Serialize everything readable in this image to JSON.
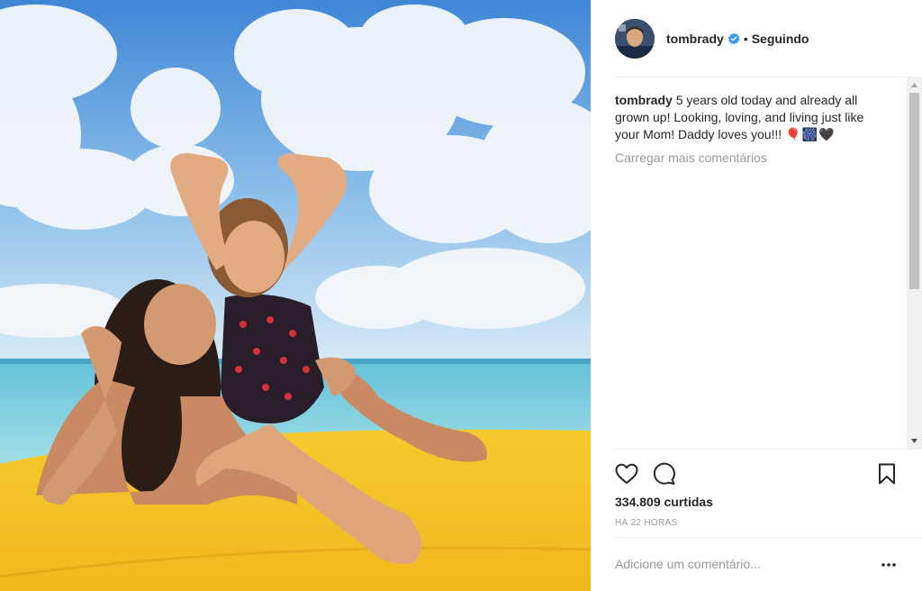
{
  "header": {
    "username": "tombrady",
    "verified_icon": "verified-badge-icon",
    "separator": "•",
    "follow_status": "Seguindo",
    "avatar_icon": "avatar"
  },
  "caption": {
    "username": "tombrady",
    "text": "5 years old today and already all grown up! Looking, loving, and living just like your Mom! Daddy loves you!!!",
    "emoji": "🎈🎆🖤"
  },
  "comments": {
    "load_more": "Carregar mais comentários"
  },
  "actions": {
    "like_icon": "heart-icon",
    "comment_icon": "comment-bubble-icon",
    "save_icon": "bookmark-icon"
  },
  "likes": "334.809 curtidas",
  "timestamp": "HÁ 22 HORAS",
  "add_comment": {
    "placeholder": "Adicione um comentário...",
    "more_icon": "more-options-icon"
  },
  "colors": {
    "text": "#262626",
    "muted": "#999999",
    "verified": "#3897f0",
    "divider": "#efefef"
  }
}
